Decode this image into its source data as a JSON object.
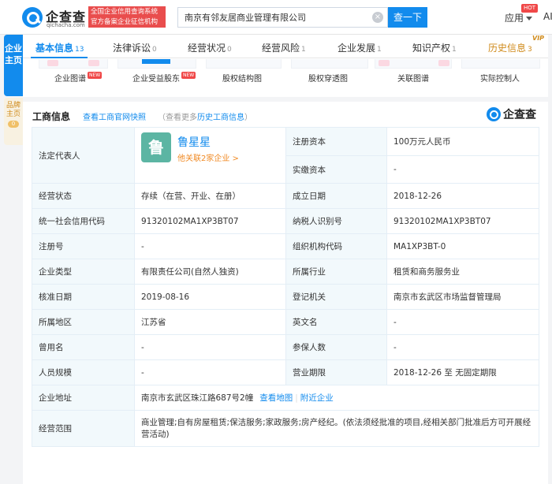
{
  "header": {
    "logo_name": "企查查",
    "logo_domain": "qichacha.com",
    "slogan_line1": "全国企业信用查询系统",
    "slogan_line2": "官方备案企业征信机构",
    "search_value": "南京有邻友居商业管理有限公司",
    "search_button": "查一下",
    "app_label": "应用",
    "hot_badge": "HOT",
    "user_cut": "AI"
  },
  "side_tabs": {
    "main": "企业主页",
    "brand": "品牌主页",
    "brand_count": "0"
  },
  "tabs": [
    {
      "label": "基本信息",
      "count": "13"
    },
    {
      "label": "法律诉讼",
      "count": "0"
    },
    {
      "label": "经营状况",
      "count": "0"
    },
    {
      "label": "经营风险",
      "count": "1"
    },
    {
      "label": "企业发展",
      "count": "1"
    },
    {
      "label": "知识产权",
      "count": "1"
    },
    {
      "label": "历史信息",
      "count": "3"
    }
  ],
  "vip_badge": "VIP",
  "sub_items": [
    {
      "label": "企业图谱",
      "tag": "NEW"
    },
    {
      "label": "企业受益股东",
      "tag": "NEW"
    },
    {
      "label": "股权结构图",
      "tag": ""
    },
    {
      "label": "股权穿透图",
      "tag": ""
    },
    {
      "label": "关联图谱",
      "tag": ""
    },
    {
      "label": "实际控制人",
      "tag": ""
    }
  ],
  "section": {
    "title": "工商信息",
    "snapshot_link": "查看工商官网快照",
    "hint_prefix": "（查看更多",
    "hint_link": "历史工商信息",
    "hint_suffix": "）",
    "watermark": "企查查"
  },
  "legal_rep": {
    "label": "法定代表人",
    "avatar_char": "鲁",
    "name": "鲁星星",
    "related": "他关联2家企业 >"
  },
  "fields": {
    "reg_capital_label": "注册资本",
    "reg_capital": "100万元人民币",
    "paid_capital_label": "实缴资本",
    "paid_capital": "-",
    "status_label": "经营状态",
    "status": "存续（在营、开业、在册）",
    "founded_label": "成立日期",
    "founded": "2018-12-26",
    "credit_code_label": "统一社会信用代码",
    "credit_code": "91320102MA1XP3BT07",
    "taxpayer_label": "纳税人识别号",
    "taxpayer": "91320102MA1XP3BT07",
    "reg_no_label": "注册号",
    "reg_no": "-",
    "org_code_label": "组织机构代码",
    "org_code": "MA1XP3BT-0",
    "type_label": "企业类型",
    "type": "有限责任公司(自然人独资)",
    "industry_label": "所属行业",
    "industry": "租赁和商务服务业",
    "approval_label": "核准日期",
    "approval": "2019-08-16",
    "authority_label": "登记机关",
    "authority": "南京市玄武区市场监督管理局",
    "region_label": "所属地区",
    "region": "江苏省",
    "english_label": "英文名",
    "english": "-",
    "former_label": "曾用名",
    "former": "-",
    "insured_label": "参保人数",
    "insured": "-",
    "staff_label": "人员规模",
    "staff": "-",
    "term_label": "营业期限",
    "term": "2018-12-26 至 无固定期限",
    "address_label": "企业地址",
    "address": "南京市玄武区珠江路687号2幢",
    "map_link": "查看地图",
    "nearby_link": "附近企业",
    "scope_label": "经营范围",
    "scope": "商业管理;自有房屋租赁;保洁服务;家政服务;房产经纪。(依法须经批准的项目,经相关部门批准后方可开展经营活动)"
  }
}
